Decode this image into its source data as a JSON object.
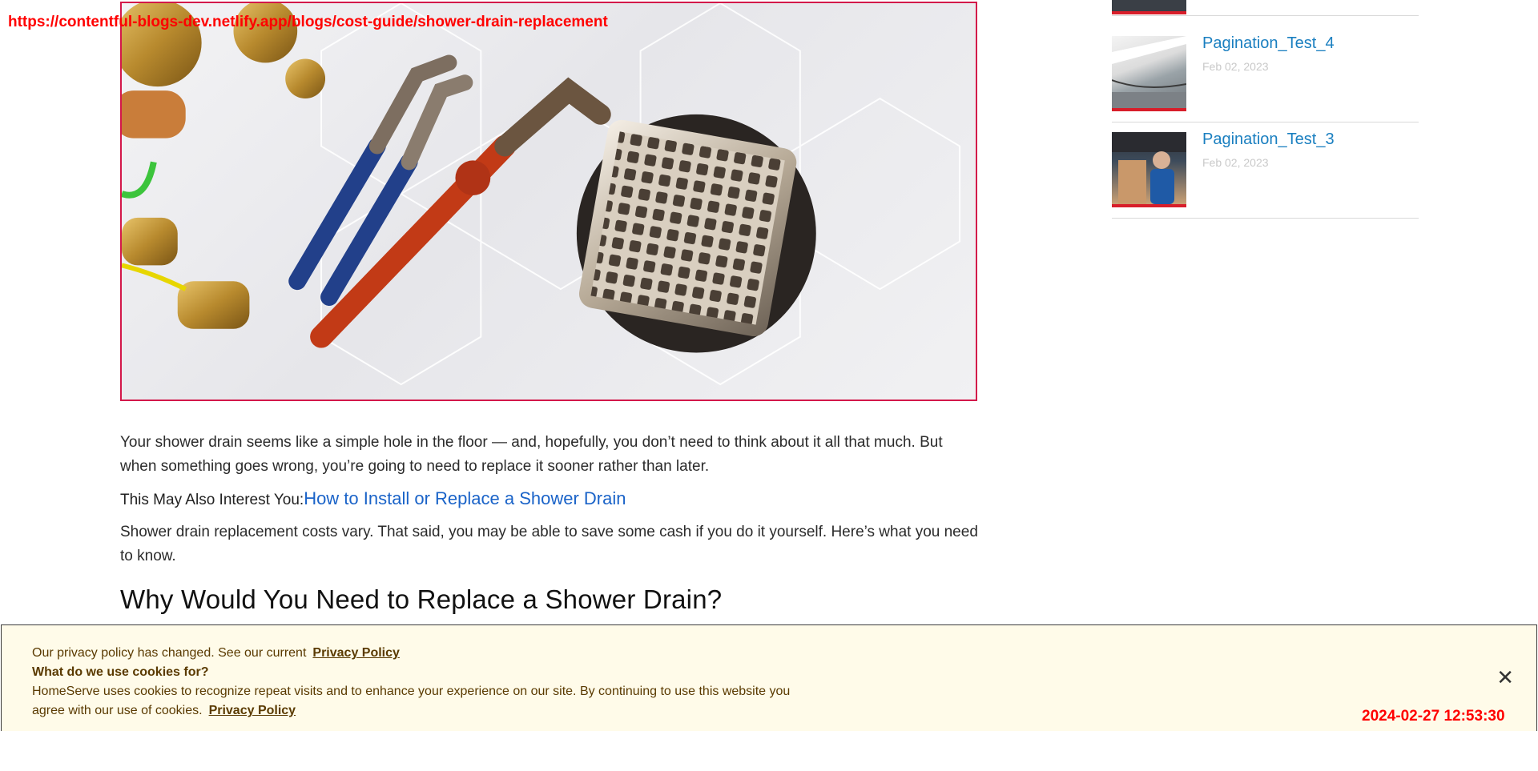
{
  "overlay": {
    "url": "https://contentful-blogs-dev.netlify.app/blogs/cost-guide/shower-drain-replacement",
    "timestamp": "2024-02-27 12:53:30"
  },
  "article": {
    "intro": "Your shower drain seems like a simple hole in the floor — and, hopefully, you don’t need to think about it all that much. But when something goes wrong, you’re going to need to replace it sooner rather than later.",
    "interest_label": "This May Also Interest You:",
    "interest_link": "How to Install or Replace a Shower Drain",
    "cost_para": "Shower drain replacement costs vary. That said, you may be able to save some cash if you do it yourself. Here’s what you need to know.",
    "heading": "Why Would You Need to Replace a Shower Drain?"
  },
  "sidebar": {
    "items": [
      {
        "title": "Pagination_Test_4",
        "date": "Feb 02, 2023"
      },
      {
        "title": "Pagination_Test_3",
        "date": "Feb 02, 2023"
      }
    ]
  },
  "cookie": {
    "line1": "Our privacy policy has changed. See our current",
    "link1": "Privacy Policy",
    "line2": "What do we use cookies for?",
    "line3": "HomeServe uses cookies to recognize repeat visits and to enhance your experience on our site. By continuing to use this website you",
    "line4": "agree with our use of cookies.",
    "link2": "Privacy Policy",
    "close": "✕"
  }
}
